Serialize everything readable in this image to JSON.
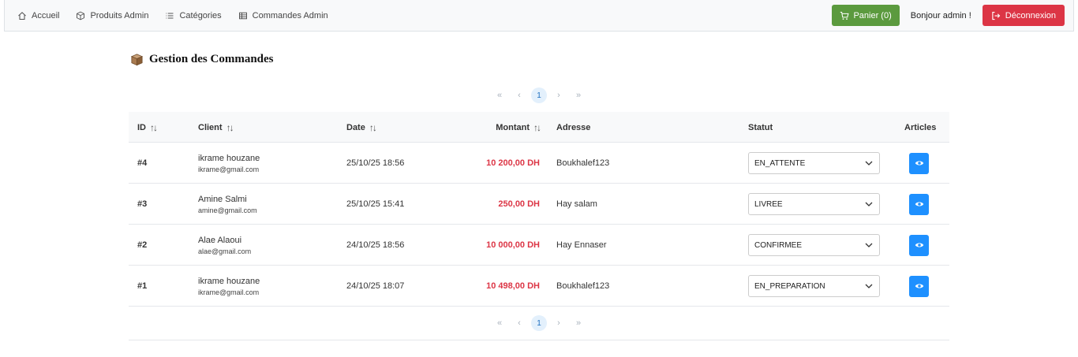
{
  "nav": {
    "items": [
      {
        "label": "Accueil",
        "icon": "home-icon"
      },
      {
        "label": "Produits Admin",
        "icon": "box-icon"
      },
      {
        "label": "Catégories",
        "icon": "list-icon"
      },
      {
        "label": "Commandes Admin",
        "icon": "table-icon"
      }
    ],
    "cart_label": "Panier (0)",
    "greeting": "Bonjour admin !",
    "logout_label": "Déconnexion"
  },
  "colors": {
    "cart_button": "#5b9a3e",
    "logout_button": "#dc3545",
    "amount": "#dc3545",
    "view_button": "#1e90ff"
  },
  "page": {
    "title": "Gestion des Commandes",
    "title_icon": "package-icon"
  },
  "pagination": {
    "first": "«",
    "prev": "‹",
    "current": "1",
    "next": "›",
    "last": "»"
  },
  "table": {
    "headers": {
      "id": "ID",
      "client": "Client",
      "date": "Date",
      "amount": "Montant",
      "address": "Adresse",
      "status": "Statut",
      "articles": "Articles"
    },
    "rows": [
      {
        "id": "#4",
        "client_name": "ikrame houzane",
        "client_email": "ikrame@gmail.com",
        "date": "25/10/25 18:56",
        "amount": "10 200,00 DH",
        "address": "Boukhalef123",
        "status": "EN_ATTENTE"
      },
      {
        "id": "#3",
        "client_name": "Amine Salmi",
        "client_email": "amine@gmail.com",
        "date": "25/10/25 15:41",
        "amount": "250,00 DH",
        "address": "Hay salam",
        "status": "LIVREE"
      },
      {
        "id": "#2",
        "client_name": "Alae Alaoui",
        "client_email": "alae@gmail.com",
        "date": "24/10/25 18:56",
        "amount": "10 000,00 DH",
        "address": "Hay Ennaser",
        "status": "CONFIRMEE"
      },
      {
        "id": "#1",
        "client_name": "ikrame houzane",
        "client_email": "ikrame@gmail.com",
        "date": "24/10/25 18:07",
        "amount": "10 498,00 DH",
        "address": "Boukhalef123",
        "status": "EN_PREPARATION"
      }
    ]
  }
}
